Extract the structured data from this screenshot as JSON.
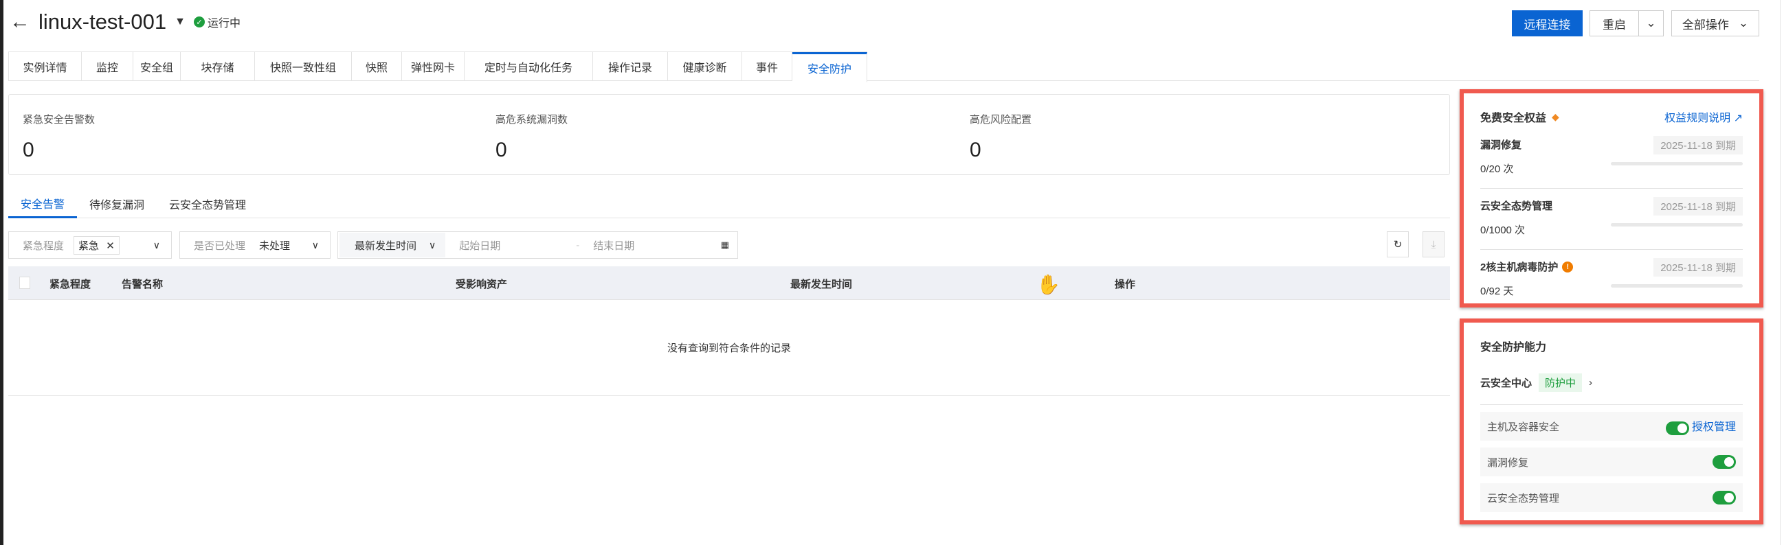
{
  "header": {
    "title": "linux-test-001",
    "status": "运行中",
    "buttons": {
      "remote": "远程连接",
      "restart": "重启",
      "all_ops": "全部操作"
    }
  },
  "tabs": [
    "实例详情",
    "监控",
    "安全组",
    "块存储",
    "快照一致性组",
    "快照",
    "弹性网卡",
    "定时与自动化任务",
    "操作记录",
    "健康诊断",
    "事件",
    "安全防护"
  ],
  "stats": [
    {
      "label": "紧急安全告警数",
      "value": "0"
    },
    {
      "label": "高危系统漏洞数",
      "value": "0"
    },
    {
      "label": "高危风险配置",
      "value": "0"
    }
  ],
  "subtabs": [
    "安全告警",
    "待修复漏洞",
    "云安全态势管理"
  ],
  "filters": {
    "severity_label": "紧急程度",
    "severity_value": "紧急",
    "handled_label": "是否已处理",
    "handled_value": "未处理",
    "time_field": "最新发生时间",
    "start_placeholder": "起始日期",
    "end_placeholder": "结束日期"
  },
  "table": {
    "columns": [
      "紧急程度",
      "告警名称",
      "受影响资产",
      "最新发生时间",
      "操作"
    ],
    "empty": "没有查询到符合条件的记录"
  },
  "benefits": {
    "title": "免费安全权益",
    "link": "权益规则说明",
    "items": [
      {
        "name": "漏洞修复",
        "usage": "0/20 次",
        "expiry": "2025-11-18 到期",
        "progress": 0
      },
      {
        "name": "云安全态势管理",
        "usage": "0/1000 次",
        "expiry": "2025-11-18 到期",
        "progress": 0
      },
      {
        "name": "2核主机病毒防护",
        "usage": "0/92 天",
        "expiry": "2025-11-18 到期",
        "progress": 0
      }
    ]
  },
  "protection": {
    "title": "安全防护能力",
    "center": "云安全中心",
    "center_status": "防护中",
    "features": [
      {
        "name": "主机及容器安全",
        "enabled": true,
        "link": "授权管理"
      },
      {
        "name": "漏洞修复",
        "enabled": true
      },
      {
        "name": "云安全态势管理",
        "enabled": true
      }
    ]
  }
}
